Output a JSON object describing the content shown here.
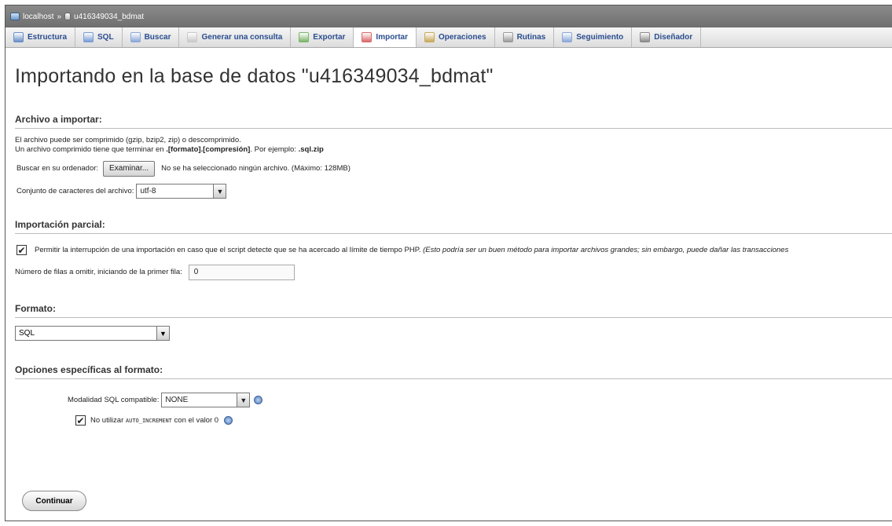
{
  "breadcrumb": {
    "server": "localhost",
    "separator": "»",
    "database": "u416349034_bdmat"
  },
  "tabs": [
    {
      "label": "Estructura",
      "icon": "structure-icon",
      "color": "#6b8ec9"
    },
    {
      "label": "SQL",
      "icon": "sql-icon",
      "color": "#7a9bd6"
    },
    {
      "label": "Buscar",
      "icon": "search-icon",
      "color": "#8aa7d8"
    },
    {
      "label": "Generar una consulta",
      "icon": "query-icon",
      "color": "#c9c9c9"
    },
    {
      "label": "Exportar",
      "icon": "export-icon",
      "color": "#7bb46a"
    },
    {
      "label": "Importar",
      "icon": "import-icon",
      "color": "#d96a6a",
      "active": true
    },
    {
      "label": "Operaciones",
      "icon": "wrench-icon",
      "color": "#c9a95a"
    },
    {
      "label": "Rutinas",
      "icon": "routines-icon",
      "color": "#9a9a9a"
    },
    {
      "label": "Seguimiento",
      "icon": "eye-icon",
      "color": "#8aa7d8"
    },
    {
      "label": "Diseñador",
      "icon": "designer-icon",
      "color": "#8a8a8a"
    }
  ],
  "page_title": "Importando en la base de datos \"u416349034_bdmat\"",
  "file_section": {
    "heading": "Archivo a importar:",
    "line1": "El archivo puede ser comprimido (gzip, bzip2, zip) o descomprimido.",
    "line2_prefix": "Un archivo comprimido tiene que terminar en ",
    "line2_bold": ".[formato].[compresión]",
    "line2_mid": ". Por ejemplo: ",
    "line2_example": ".sql.zip",
    "browse_label": "Buscar en su ordenador:",
    "browse_button": "Examinar...",
    "no_file": "No se ha seleccionado ningún archivo.",
    "max_size": "(Máximo: 128MB)",
    "charset_label": "Conjunto de caracteres del archivo:",
    "charset_value": "utf-8"
  },
  "partial_section": {
    "heading": "Importación parcial:",
    "interrupt_checked": true,
    "interrupt_label": "Permitir la interrupción de una importación en caso que el script detecte que se ha acercado al límite de tiempo PHP.",
    "interrupt_note": "(Esto podría ser un buen método para importar archivos grandes; sin embargo, puede dañar las transacciones",
    "skip_label": "Número de filas a omitir, iniciando de la primer fila:",
    "skip_value": "0"
  },
  "format_section": {
    "heading": "Formato:",
    "format_value": "SQL"
  },
  "options_section": {
    "heading": "Opciones específicas al formato:",
    "compat_label": "Modalidad SQL compatible:",
    "compat_value": "NONE",
    "auto_inc_checked": true,
    "auto_inc_prefix": "No utilizar",
    "auto_inc_code": "AUTO_INCREMENT",
    "auto_inc_suffix": "con el valor 0"
  },
  "submit_label": "Continuar"
}
